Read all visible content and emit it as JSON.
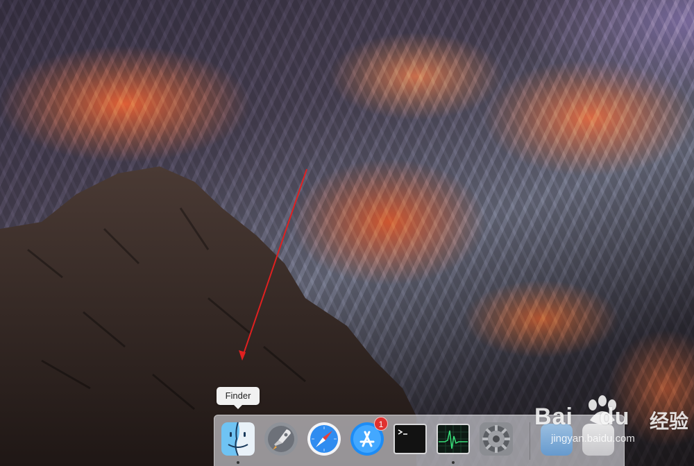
{
  "tooltip": {
    "text": "Finder"
  },
  "dock": {
    "items": [
      {
        "name": "Finder",
        "icon": "finder-icon",
        "running": true
      },
      {
        "name": "Launchpad",
        "icon": "launchpad-icon",
        "running": false
      },
      {
        "name": "Safari",
        "icon": "safari-icon",
        "running": false
      },
      {
        "name": "App Store",
        "icon": "app-store-icon",
        "running": false,
        "badge": "1"
      },
      {
        "name": "Terminal",
        "icon": "terminal-icon",
        "running": false
      },
      {
        "name": "Activity Monitor",
        "icon": "activity-monitor-icon",
        "running": true
      },
      {
        "name": "System Preferences",
        "icon": "system-preferences-icon",
        "running": false
      }
    ]
  },
  "watermark": {
    "brand": "Bai",
    "brand_suffix": "du",
    "sub": "经验",
    "url": "jingyan.baidu.com"
  },
  "colors": {
    "annotation_arrow": "#e02020",
    "badge": "#e0312f"
  }
}
